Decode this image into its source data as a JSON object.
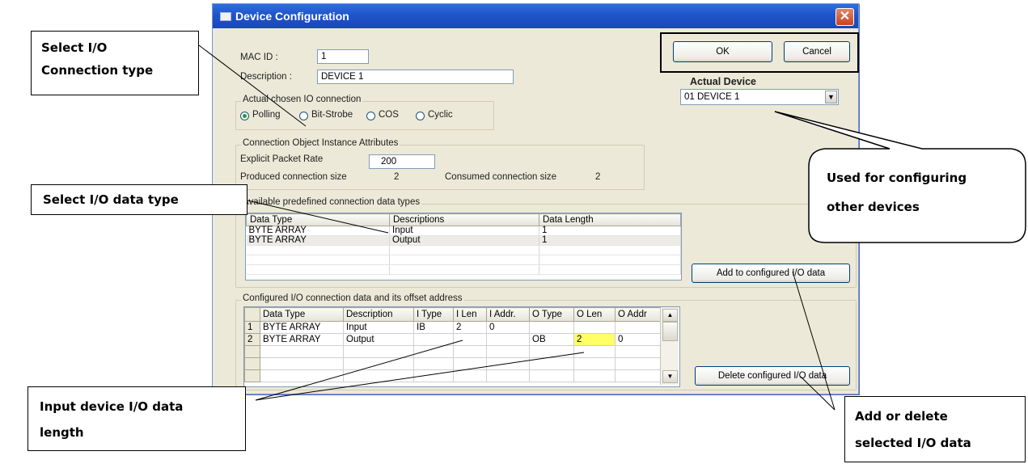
{
  "dialog": {
    "title": "Device Configuration",
    "close_glyph": "✕",
    "mac_id_label": "MAC ID :",
    "mac_id_value": "1",
    "description_label": "Description :",
    "description_value": "DEVICE 1",
    "ok_label": "OK",
    "cancel_label": "Cancel",
    "actual_device_label": "Actual Device",
    "actual_device_value": "01  DEVICE 1",
    "io_group_title": "Actual chosen IO connection",
    "io_options": [
      "Polling",
      "Bit-Strobe",
      "COS",
      "Cyclic"
    ],
    "io_selected": "Polling",
    "conn_group_title": "Connection Object Instance Attributes",
    "packet_rate_label": "Explicit Packet Rate",
    "packet_rate_value": "200",
    "produced_label": "Produced connection size",
    "produced_value": "2",
    "consumed_label": "Consumed connection size",
    "consumed_value": "2",
    "predefined_group_title": "Available predefined connection data types",
    "predefined_headers": [
      "Data Type",
      "Descriptions",
      "Data Length"
    ],
    "predefined_rows": [
      [
        "BYTE ARRAY",
        "Input",
        "1"
      ],
      [
        "BYTE ARRAY",
        "Output",
        "1"
      ]
    ],
    "add_button_label": "Add to configured I/O data",
    "configured_group_title": "Configured I/O connection data and its offset address",
    "configured_headers": [
      "Data Type",
      "Description",
      "I Type",
      "I Len",
      "I Addr.",
      "O Type",
      "O Len",
      "O Addr"
    ],
    "configured_rows": [
      {
        "num": "1",
        "cells": [
          "BYTE ARRAY",
          "Input",
          "IB",
          "2",
          "0",
          "",
          "",
          ""
        ]
      },
      {
        "num": "2",
        "cells": [
          "BYTE ARRAY",
          "Output",
          "",
          "",
          "",
          "OB",
          "2",
          "0"
        ]
      }
    ],
    "delete_button_label": "Delete configured I/O data",
    "highlight_color": "#ffff66"
  },
  "callouts": {
    "connection_type": [
      "Select I/O",
      "Connection type"
    ],
    "data_type": "Select I/O data type",
    "other_devices": [
      "Used for configuring",
      "other devices"
    ],
    "input_length": [
      "Input device I/O data",
      "length"
    ],
    "add_delete": [
      "Add or delete",
      "selected I/O data"
    ]
  }
}
